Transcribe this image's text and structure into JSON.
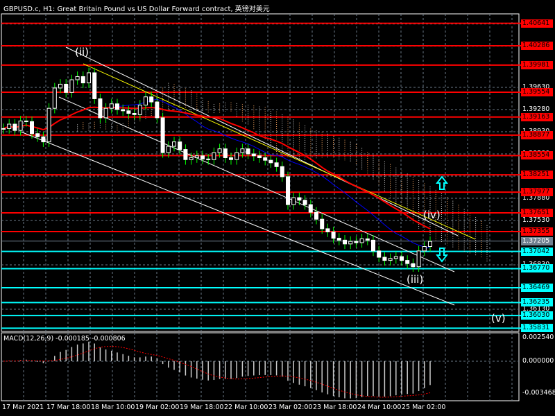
{
  "header": {
    "title": "GBPUSD.c, H1:  Great Britain Pound vs US Dollar Forward contract, 英镑对美元"
  },
  "colors": {
    "background": "#000000",
    "resistance": "#ff0000",
    "support": "#00ffff",
    "bid": "#708090",
    "candle_up": "#ffffff",
    "candle_wick": "#00ff00",
    "ma_fast": "#ff0000",
    "ma_slow": "#0000ff",
    "signal": "#ff0000",
    "trendline": "#ffff00",
    "channel": "#ffffff"
  },
  "price_axis": {
    "ticks": [
      "1.40630",
      "1.40280",
      "1.39630",
      "1.39280",
      "1.38930",
      "1.38580",
      "1.38230",
      "1.37880",
      "1.37530",
      "1.36830",
      "1.36130"
    ]
  },
  "levels": {
    "resistance": [
      "1.40641",
      "1.40286",
      "1.39981",
      "1.39554",
      "1.39163",
      "1.38877",
      "1.38554",
      "1.38251",
      "1.37977",
      "1.37651",
      "1.37355"
    ],
    "bid": "1.37205",
    "support": [
      "1.37042",
      "1.36770",
      "1.36469",
      "1.36235",
      "1.36030",
      "1.35831"
    ]
  },
  "waves": {
    "ii": "(ii)",
    "iii": "(iii)",
    "iv": "(iv)",
    "v": "(v)"
  },
  "time_axis": [
    "17 Mar 2021",
    "17 Mar 18:00",
    "18 Mar 10:00",
    "19 Mar 02:00",
    "19 Mar 18:00",
    "22 Mar 10:00",
    "23 Mar 02:00",
    "23 Mar 18:00",
    "24 Mar 10:00",
    "25 Mar 02:00"
  ],
  "macd": {
    "label": "MACD(12,26,9) -0.000185 -0.000806",
    "ticks": [
      "0.002540",
      "0.000000",
      "-0.003468"
    ]
  },
  "chart_data": {
    "type": "candlestick",
    "symbol": "GBPUSD.c",
    "timeframe": "H1",
    "closes": [
      1.3898,
      1.3905,
      1.3895,
      1.391,
      1.3909,
      1.389,
      1.3885,
      1.3877,
      1.393,
      1.3962,
      1.3968,
      1.3955,
      1.3975,
      1.398,
      1.397,
      1.3986,
      1.3945,
      1.3915,
      1.393,
      1.3937,
      1.3928,
      1.3926,
      1.3922,
      1.392,
      1.3935,
      1.3948,
      1.394,
      1.3915,
      1.386,
      1.387,
      1.3877,
      1.3865,
      1.3849,
      1.3852,
      1.3855,
      1.385,
      1.3849,
      1.386,
      1.3866,
      1.3852,
      1.3849,
      1.386,
      1.3866,
      1.3858,
      1.3855,
      1.3852,
      1.3848,
      1.3844,
      1.3838,
      1.3822,
      1.3778,
      1.3789,
      1.3785,
      1.3778,
      1.3766,
      1.3755,
      1.374,
      1.3735,
      1.3725,
      1.3722,
      1.3716,
      1.372,
      1.3718,
      1.3724,
      1.3722,
      1.3705,
      1.3695,
      1.369,
      1.3693,
      1.3696,
      1.369,
      1.3685,
      1.368,
      1.3705,
      1.3712,
      1.372
    ],
    "ylim": [
      1.357,
      1.409
    ],
    "grid": true
  }
}
